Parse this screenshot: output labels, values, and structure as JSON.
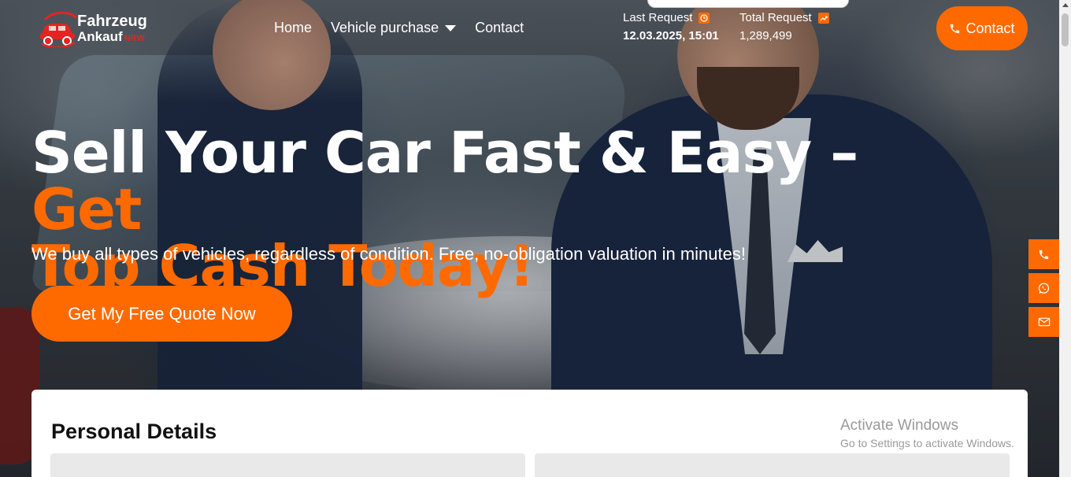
{
  "brand": {
    "line1": "Fahrzeug",
    "line2": "Ankauf",
    "suffix": "NRW",
    "accent": "#ff6a00",
    "logo_red": "#e52421"
  },
  "nav": {
    "items": [
      {
        "label": "Home"
      },
      {
        "label": "Vehicle purchase",
        "has_dropdown": true
      },
      {
        "label": "Contact"
      }
    ]
  },
  "stats": {
    "last_request": {
      "label": "Last Request",
      "value": "12.03.2025, 15:01",
      "icon": "clock-icon"
    },
    "total_request": {
      "label": "Total Request",
      "value": "1,289,499",
      "icon": "trending-up-icon"
    }
  },
  "header": {
    "contact_label": "Contact",
    "contact_icon": "phone-icon"
  },
  "hero": {
    "title_white": "Sell Your Car Fast & Easy –",
    "title_orange_1": "Get",
    "title_orange_2": "Top Cash Today!",
    "subtitle": "We buy all types of vehicles, regardless of condition. Free, no-obligation valuation in minutes!",
    "cta_label": "Get My Free Quote Now"
  },
  "side_buttons": [
    {
      "icon": "phone-icon"
    },
    {
      "icon": "whatsapp-icon"
    },
    {
      "icon": "mail-icon"
    }
  ],
  "form": {
    "title": "Personal Details"
  },
  "watermark": {
    "line1": "Activate Windows",
    "line2": "Go to Settings to activate Windows."
  }
}
